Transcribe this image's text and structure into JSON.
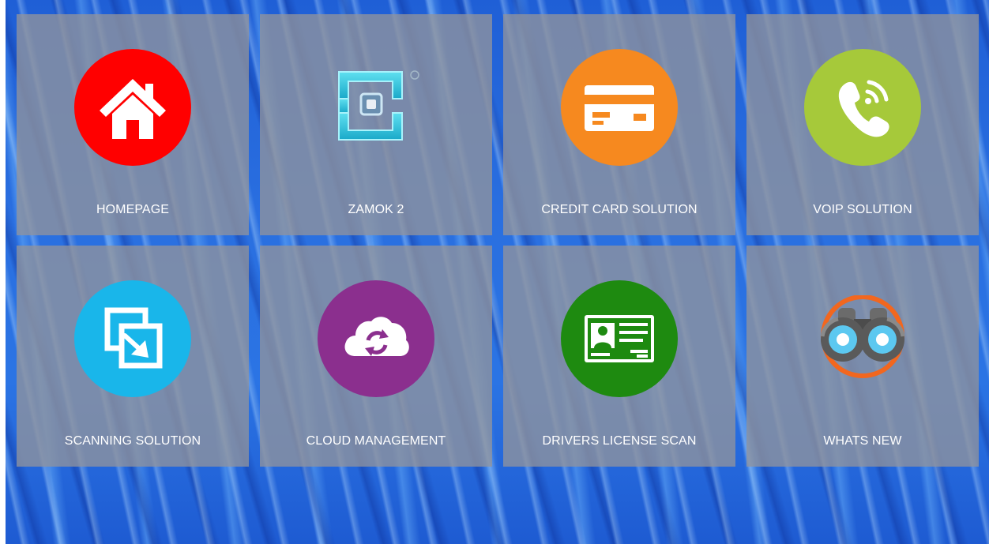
{
  "tiles": [
    {
      "label": "HOMEPAGE",
      "icon": "home-icon",
      "color": "#ff0000"
    },
    {
      "label": "ZAMOK 2",
      "icon": "zamok-logo-icon",
      "color": "#29c2dc"
    },
    {
      "label": "CREDIT CARD SOLUTION",
      "icon": "credit-card-icon",
      "color": "#f6891f"
    },
    {
      "label": "VOIP SOLUTION",
      "icon": "phone-icon",
      "color": "#a6c93a"
    },
    {
      "label": "SCANNING SOLUTION",
      "icon": "scan-icon",
      "color": "#19b6ea"
    },
    {
      "label": "CLOUD MANAGEMENT",
      "icon": "cloud-sync-icon",
      "color": "#8b2f8e"
    },
    {
      "label": "DRIVERS LICENSE SCAN",
      "icon": "id-card-icon",
      "color": "#1e8a10"
    },
    {
      "label": "WHATS NEW",
      "icon": "binoculars-icon",
      "color": "#f2671f"
    }
  ]
}
